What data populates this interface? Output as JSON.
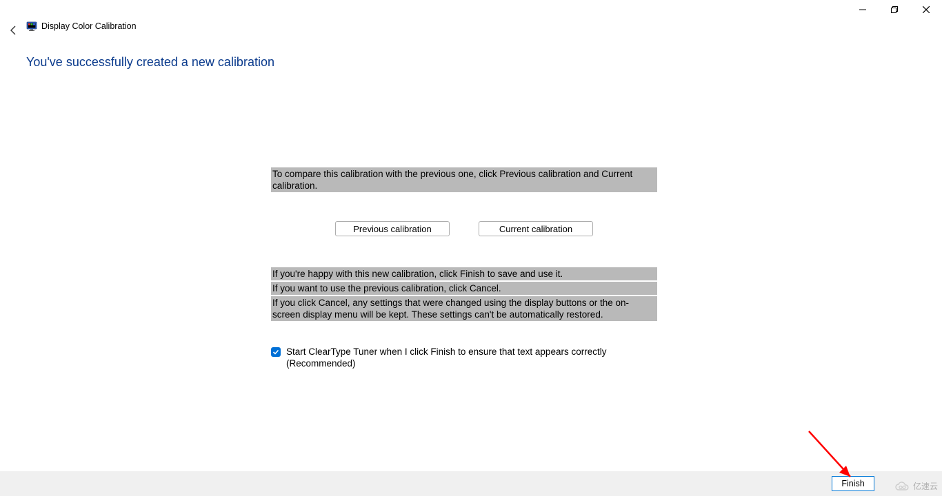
{
  "window": {
    "title": "Display Color Calibration"
  },
  "header": {
    "heading": "You've successfully created a new calibration"
  },
  "content": {
    "compare_text": "To compare this calibration with the previous one, click Previous calibration and Current calibration.",
    "prev_btn": "Previous calibration",
    "curr_btn": "Current calibration",
    "happy_text": "If you're happy with this new calibration, click Finish to save and use it.",
    "cancel_text": "If you want to use the previous calibration, click Cancel.",
    "warn_text": "If you click Cancel, any settings that were changed using the display buttons or the on-screen display menu will be kept. These settings can't be automatically restored.",
    "checkbox_label": "Start ClearType Tuner when I click Finish to ensure that text appears correctly (Recommended)",
    "checkbox_checked": true
  },
  "footer": {
    "finish": "Finish"
  },
  "watermark": {
    "text": "亿速云"
  }
}
